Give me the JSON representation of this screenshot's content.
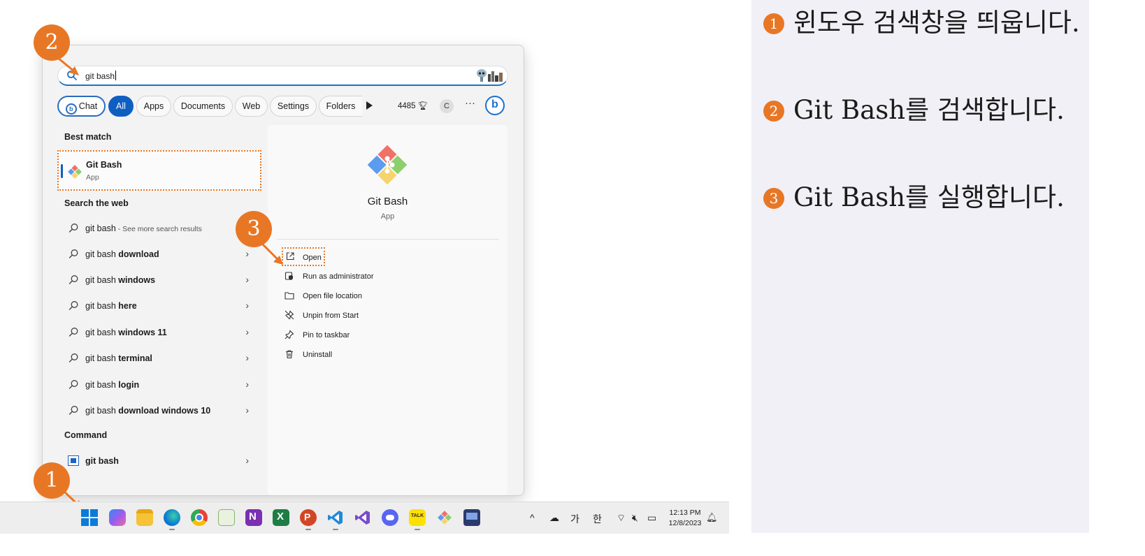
{
  "search": {
    "query": "git bash"
  },
  "filters": {
    "chat": "Chat",
    "all": "All",
    "apps": "Apps",
    "documents": "Documents",
    "web": "Web",
    "settings": "Settings",
    "folders": "Folders",
    "points": "4485",
    "profile_initial": "C",
    "more": "···",
    "bing": "b"
  },
  "left": {
    "best_match_header": "Best match",
    "best_match": {
      "name": "Git Bash",
      "type": "App"
    },
    "search_web_header": "Search the web",
    "web_results": [
      {
        "prefix": "git bash",
        "bold": "",
        "note": " - See more search results"
      },
      {
        "prefix": "git bash ",
        "bold": "download",
        "note": ""
      },
      {
        "prefix": "git bash ",
        "bold": "windows",
        "note": ""
      },
      {
        "prefix": "git bash ",
        "bold": "here",
        "note": ""
      },
      {
        "prefix": "git bash ",
        "bold": "windows 11",
        "note": ""
      },
      {
        "prefix": "git bash ",
        "bold": "terminal",
        "note": ""
      },
      {
        "prefix": "git bash ",
        "bold": "login",
        "note": ""
      },
      {
        "prefix": "git bash ",
        "bold": "download windows 10",
        "note": ""
      }
    ],
    "command_header": "Command",
    "command": "git bash"
  },
  "detail": {
    "name": "Git Bash",
    "type": "App",
    "actions": [
      "Open",
      "Run as administrator",
      "Open file location",
      "Unpin from Start",
      "Pin to taskbar",
      "Uninstall"
    ]
  },
  "callouts": [
    "1",
    "2",
    "3"
  ],
  "taskbar": {
    "apps": [
      "start-icon",
      "copilot-icon",
      "file-explorer-icon",
      "edge-icon",
      "chrome-icon",
      "image-editor-icon",
      "onenote-icon",
      "excel-icon",
      "powerpoint-icon",
      "vscode-icon",
      "visual-studio-icon",
      "discord-icon",
      "kakaotalk-icon",
      "git-logo-icon",
      "presentation-icon"
    ],
    "tray": {
      "chevron": "^",
      "ime_ga": "가",
      "ime_han": "한"
    },
    "time": "12:13 PM",
    "date": "12/8/2023"
  },
  "steps": [
    {
      "num": "1",
      "text": "윈도우 검색창을 띄웁니다."
    },
    {
      "num": "2",
      "text": "Git Bash를 검색합니다."
    },
    {
      "num": "3",
      "text": "Git Bash를 실행합니다."
    }
  ],
  "colors": {
    "accent": "#e87725",
    "selection": "#0f5fc2"
  }
}
